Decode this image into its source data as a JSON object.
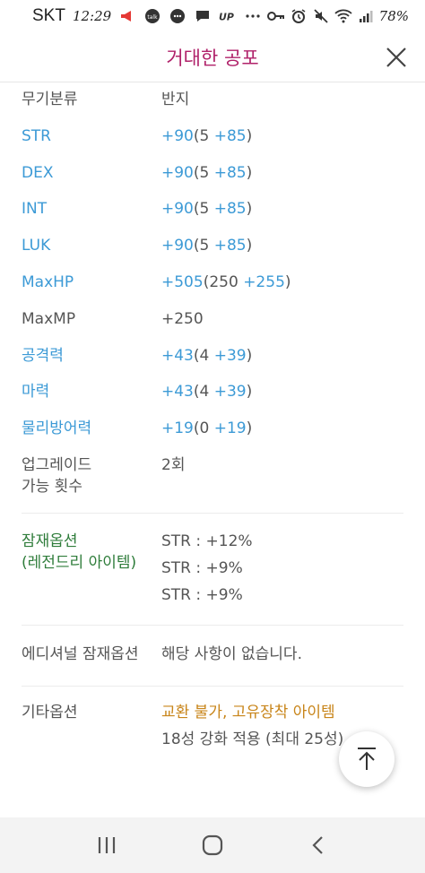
{
  "status": {
    "carrier": "SKT",
    "time": "12:29",
    "battery": "78%"
  },
  "header": {
    "title": "거대한 공포"
  },
  "rows": [
    {
      "label": "무기분류",
      "value": "반지"
    },
    {
      "label": "STR",
      "total": "+90",
      "base": "(5 ",
      "bonus": "+85",
      "close": ")"
    },
    {
      "label": "DEX",
      "total": "+90",
      "base": "(5 ",
      "bonus": "+85",
      "close": ")"
    },
    {
      "label": "INT",
      "total": "+90",
      "base": "(5 ",
      "bonus": "+85",
      "close": ")"
    },
    {
      "label": "LUK",
      "total": "+90",
      "base": "(5 ",
      "bonus": "+85",
      "close": ")"
    },
    {
      "label": "MaxHP",
      "total": "+505",
      "base": "(250 ",
      "bonus": "+255",
      "close": ")"
    },
    {
      "label": "MaxMP",
      "value": "+250"
    },
    {
      "label": "공격력",
      "total": "+43",
      "base": "(4 ",
      "bonus": "+39",
      "close": ")"
    },
    {
      "label": "마력",
      "total": "+43",
      "base": "(4 ",
      "bonus": "+39",
      "close": ")"
    },
    {
      "label": "물리방어력",
      "total": "+19",
      "base": "(0 ",
      "bonus": "+19",
      "close": ")"
    }
  ],
  "upgrade": {
    "label_line1": "업그레이드",
    "label_line2": "가능 횟수",
    "value": "2회"
  },
  "potential": {
    "label_line1": "잠재옵션",
    "label_line2": "(레전드리 아이템)",
    "lines": [
      "STR : +12%",
      "STR : +9%",
      "STR : +9%"
    ]
  },
  "additional": {
    "label": "에디셔널 잠재옵션",
    "value": "해당 사항이 없습니다."
  },
  "etc": {
    "label": "기타옵션",
    "line1": "교환 불가, 고유장착 아이템",
    "line2": "18성 강화 적용 (최대 25성)"
  },
  "colors": {
    "title": "#b0226a",
    "stat_blue": "#3c9ad6",
    "potential_green": "#2f7d3b",
    "etc_orange": "#c8851a"
  }
}
